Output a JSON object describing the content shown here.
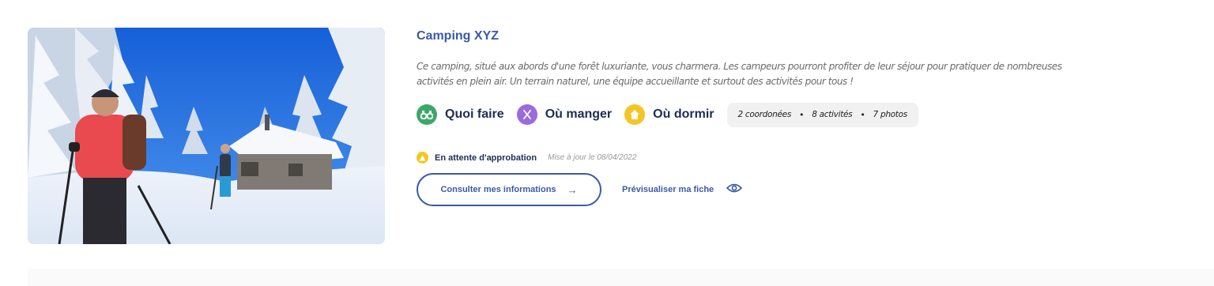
{
  "listing": {
    "title": "Camping XYZ",
    "description": "Ce camping, situé aux abords d'une forêt luxuriante, vous charmera. Les campeurs pourront profiter de leur séjour pour pratiquer de nombreuses activités en plein air. Un terrain naturel, une équipe accueillante et surtout des activités pour tous !",
    "image_icon": "snowshoe-hikers-cabin-photo",
    "tags": [
      {
        "label": "Quoi faire",
        "icon": "binoculars-icon",
        "color": "#3aa868"
      },
      {
        "label": "Où manger",
        "icon": "utensils-icon",
        "color": "#9b6bdc"
      },
      {
        "label": "Où dormir",
        "icon": "house-icon",
        "color": "#f3c623"
      }
    ],
    "stats": {
      "coordinates": "2 coordonées",
      "activities": "8 activités",
      "photos": "7 photos",
      "separator": "•"
    },
    "status": {
      "label": "En attente d'approbation",
      "icon": "warning-icon",
      "color": "#f3c623",
      "updated": "Mise à jour le 08/04/2022"
    },
    "actions": {
      "consult_label": "Consulter mes informations",
      "consult_arrow": "→",
      "preview_label": "Prévisualiser ma fiche",
      "preview_icon": "eye-icon"
    }
  },
  "colors": {
    "primary": "#3a5aa8",
    "dark": "#1f2d54",
    "muted": "#6b6b6b"
  }
}
